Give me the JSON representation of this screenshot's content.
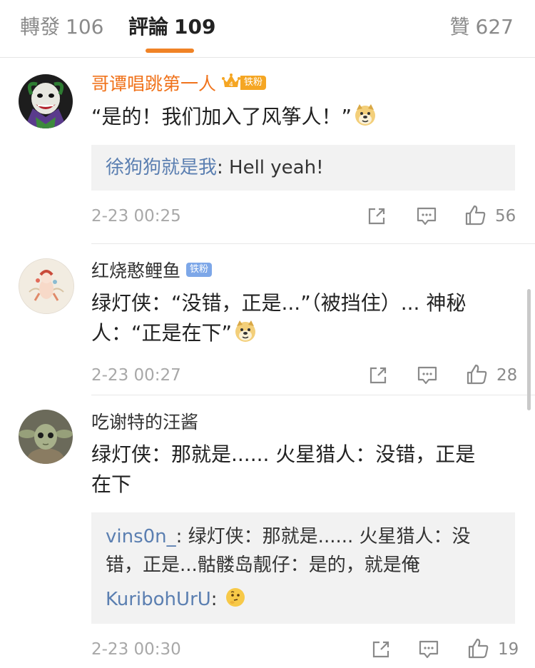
{
  "tabs": {
    "reposts": {
      "label": "轉發",
      "count": "106"
    },
    "comments": {
      "label": "評論",
      "count": "109"
    },
    "likes": {
      "label": "贊",
      "count": "627"
    }
  },
  "colors": {
    "accent": "#f08326",
    "link": "#5b7fb1",
    "iron_fan_orange": "#f5a623",
    "iron_fan_blue": "#7da7e8"
  },
  "comments": [
    {
      "name": "哥谭唱跳第一人",
      "badge": "铁粉",
      "text": "“是的！我们加入了风筝人！”",
      "emoji": "doge-emoji",
      "replies": [
        {
          "user": "徐狗狗就是我",
          "text": ": Hell yeah!"
        }
      ],
      "time": "2-23 00:25",
      "likes": "56"
    },
    {
      "name": "红烧憨鲤鱼",
      "badge": "铁粉",
      "text_line1": "绿灯侠：“没错，正是...”（被挡住）... 神秘",
      "text_line2": "人：“正是在下”",
      "emoji": "doge-emoji",
      "time": "2-23 00:27",
      "likes": "28"
    },
    {
      "name": "吃谢特的汪酱",
      "text_line1": "绿灯侠：那就是...... 火星猎人：没错，正是",
      "text_line2": "在下",
      "replies": [
        {
          "user": "vins0n_",
          "text_line1": ": 绿灯侠：那就是...... 火星猎人：没",
          "text_line2": "错，正是...骷髅岛靓仔：是的，就是俺"
        },
        {
          "user": "KuribohUrU",
          "text": ": ",
          "emoji": "thinking-emoji"
        }
      ],
      "time": "2-23 00:30",
      "likes": "19"
    }
  ],
  "actions": {
    "share_icon": "share-icon",
    "comment_icon": "comment-icon",
    "like_icon": "thumbs-up-icon"
  }
}
